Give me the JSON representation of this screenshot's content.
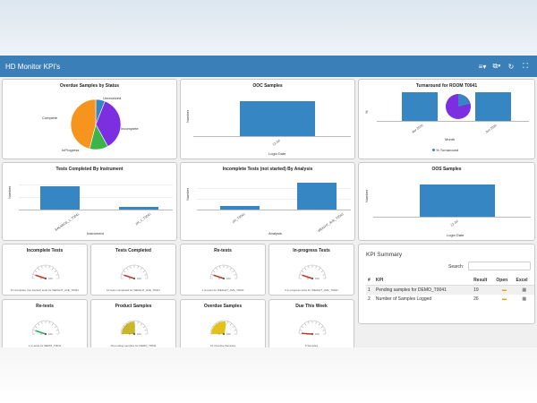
{
  "app": {
    "title": "HD Monitor KPI's"
  },
  "toolbar": {
    "menu_icon": "≡▾",
    "copy_icon": "⧉▾",
    "refresh_icon": "↻",
    "expand_icon": "⛶"
  },
  "cards": {
    "overdue": {
      "title": "Overdue Samples by Status",
      "chart_data": {
        "type": "pie",
        "title": "Overdue Samples by Status",
        "series": [
          {
            "name": "Unreceived",
            "value": 6,
            "color": "#3586c2"
          },
          {
            "name": "Incomplete",
            "value": 36,
            "color": "#7b2fe0"
          },
          {
            "name": "InProgress",
            "value": 12,
            "color": "#3bb54a"
          },
          {
            "name": "Complete",
            "value": 46,
            "color": "#f7941d"
          }
        ],
        "labels": {
          "unreceived": "Unreceived",
          "incomplete": "Incomplete",
          "inprogress": "InProgress",
          "complete": "Complete"
        }
      }
    },
    "ooc": {
      "title": "OOC Samples",
      "chart_data": {
        "type": "bar",
        "categories": [
          "12 Jul"
        ],
        "values": [
          1
        ],
        "ylim": [
          0,
          1.25
        ],
        "xlabel": "Login Date",
        "ylabel": "Number"
      }
    },
    "turnaround": {
      "title": "Turnaround for ROOM T0041",
      "chart_data": {
        "type": "bar",
        "categories": [
          "Apr 2020",
          "Jun 2020"
        ],
        "values": [
          1,
          1
        ],
        "xlabel": "Month",
        "ylabel": "%",
        "legend": "% Turnaround"
      }
    },
    "instrument": {
      "title": "Tests Completed By Instrument",
      "chart_data": {
        "type": "bar",
        "categories": [
          "BALANCE_1_T0041",
          "pH_1_T0041"
        ],
        "values": [
          10,
          1
        ],
        "ylim": [
          0,
          12
        ],
        "xlabel": "Instrument",
        "ylabel": "Number"
      }
    },
    "incomplete_analysis": {
      "title": "Incomplete Tests (not started) By Analysis",
      "chart_data": {
        "type": "bar",
        "categories": [
          "pH_T0041",
          "WEIGHT_AVE_T0041"
        ],
        "values": [
          1,
          7
        ],
        "ylim": [
          0,
          8
        ],
        "xlabel": "Analysis",
        "ylabel": "Number"
      }
    },
    "oos": {
      "title": "OOS Samples",
      "chart_data": {
        "type": "bar",
        "categories": [
          "12 Jul"
        ],
        "values": [
          1
        ],
        "ylim": [
          0,
          1.25
        ],
        "xlabel": "Login Date",
        "ylabel": "Number"
      }
    }
  },
  "gauges": [
    {
      "title": "Incomplete Tests",
      "caption": "8 incomplete (not started) tests for WEIGHT_AVE_T0041",
      "needle": 0.1,
      "color": "#c0392b",
      "min": "0",
      "max": "100",
      "fill": 0
    },
    {
      "title": "Tests Completed",
      "caption": "10 tests completed for WEIGHT_AVE_T0041",
      "needle": 0.1,
      "color": "#c0392b",
      "min": "0",
      "max": "100",
      "fill": 0
    },
    {
      "title": "Re-tests",
      "caption": "1 re-tests for WEIGHT_AVE_T0041",
      "needle": 0.1,
      "color": "#c0392b",
      "min": "0",
      "max": "100",
      "fill": 0
    },
    {
      "title": "In-progress Tests",
      "caption": "0 in-progress tests for WEIGHT_AVE_T0041",
      "needle": 0.1,
      "color": "#c0392b",
      "min": "0",
      "max": "100",
      "fill": 0
    },
    {
      "title": "Re-tests",
      "caption": "1 re-tests for DEMO_T0041",
      "needle": 0.1,
      "color": "#27ae60",
      "min": "0",
      "max": "100",
      "fill": 0
    },
    {
      "title": "Product Samples",
      "caption": "19 pending samples for DEMO_T0041",
      "needle": 0.5,
      "color": "#c9b72a",
      "min": "0",
      "max": "100",
      "fill": 0.5
    },
    {
      "title": "Overdue Samples",
      "caption": "21 Overdue Samples",
      "needle": 0.55,
      "color": "#e0c21a",
      "min": "0",
      "max": "100",
      "fill": 0.55
    },
    {
      "title": "Due This Week",
      "caption": "0 Samples",
      "needle": 0.02,
      "color": "#c0392b",
      "min": "0",
      "max": "100",
      "fill": 0
    }
  ],
  "kpi_summary": {
    "title": "KPI Summary",
    "search_label": "Search:",
    "columns": {
      "num": "#",
      "kpi": "KPI",
      "result": "Result",
      "open": "Open",
      "excel": "Excel"
    },
    "rows": [
      {
        "num": "1",
        "kpi": "Pending samples for DEMO_T0041",
        "result": "19"
      },
      {
        "num": "2",
        "kpi": "Number of Samples Logged",
        "result": "26"
      }
    ],
    "icons": {
      "open": "folder-icon",
      "excel": "excel-icon"
    }
  }
}
